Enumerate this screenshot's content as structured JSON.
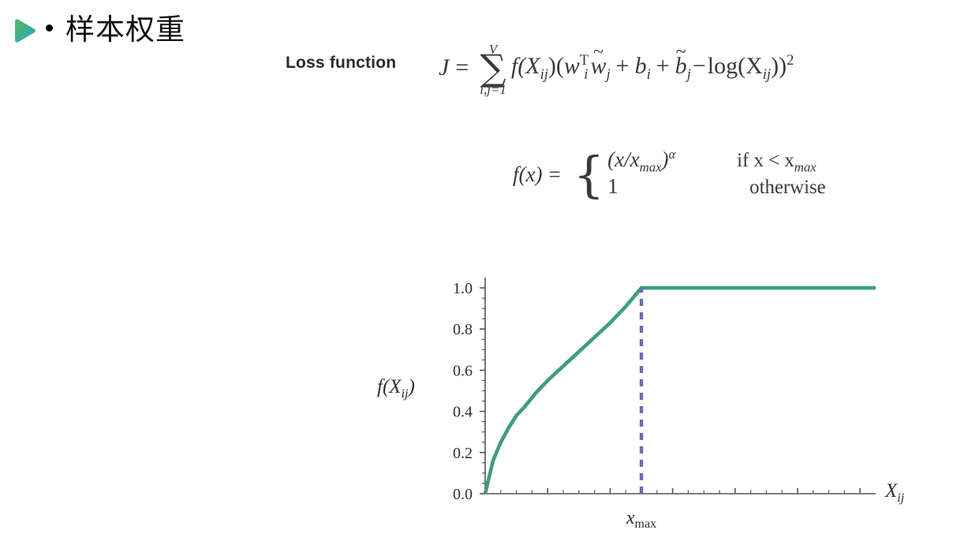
{
  "slide": {
    "heading": {
      "icon": "play-triangle-icon",
      "bullet": "•",
      "text": "样本权重"
    },
    "loss_label": "Loss function",
    "equations": {
      "main": {
        "lhs": "J",
        "equals": "=",
        "sum_upper": "V",
        "sum_symbol": "∑",
        "sum_lower": "i,j=1",
        "body_parts": {
          "weight_fn": "f(X",
          "weight_sub": "ij",
          "open": ")(",
          "w": "w",
          "w_sup": "T",
          "w_sub": "i",
          "wtilde": "w",
          "wtilde_sub": "j",
          "plus1": "+",
          "b": "b",
          "b_sub": "i",
          "plus2": "+",
          "btilde": "b",
          "btilde_sub": "j",
          "minus": "−",
          "log": "log(X",
          "log_sub": "ij",
          "close": "))",
          "power": "2"
        },
        "plain": "J = sum_{i,j=1}^{V} f(X_ij)(w_i^T w̃_j + b_i + b̃_j − log(X_ij))^2"
      },
      "piecewise": {
        "lhs": "f(x)",
        "equals": "=",
        "case1_value": "(x/x",
        "case1_value_sub": "max",
        "case1_value_close": ")",
        "case1_value_pow": "α",
        "case1_cond": "if x < x",
        "case1_cond_sub": "max",
        "case2_value": "1",
        "case2_cond": "otherwise",
        "plain": "f(x) = { (x/x_max)^alpha if x < x_max ; 1 otherwise }"
      }
    },
    "colors": {
      "curve": "#3f9d7c",
      "dashed_line": "#6b6bba",
      "axis": "#555555",
      "text": "#2f2f2f",
      "icon_gradient_start": "#4caf50",
      "icon_gradient_end": "#2aa8e0",
      "background": "#ffffff"
    }
  },
  "chart_data": {
    "type": "line",
    "title": "",
    "xlabel": "X_ij",
    "ylabel": "f(X_ij)",
    "ylim": [
      0.0,
      1.05
    ],
    "xlim": [
      0,
      1
    ],
    "y_ticks": [
      "0.0",
      "0.2",
      "0.4",
      "0.6",
      "0.8",
      "1.0"
    ],
    "y_tick_values": [
      0.0,
      0.2,
      0.4,
      0.6,
      0.8,
      1.0
    ],
    "x_ticks": [],
    "grid": false,
    "legend": false,
    "annotations": [
      {
        "name": "x-max-marker",
        "label": "x_max",
        "x": 0.4,
        "type": "vertical-dashed-line",
        "color": "#6b6bba"
      }
    ],
    "series": [
      {
        "name": "f(x) = (x/x_max)^alpha, capped at 1",
        "color": "#3f9d7c",
        "x": [
          0.0,
          0.02,
          0.04,
          0.06,
          0.08,
          0.1,
          0.13,
          0.16,
          0.2,
          0.24,
          0.28,
          0.32,
          0.36,
          0.4,
          0.55,
          0.7,
          0.85,
          1.0
        ],
        "y": [
          0.0,
          0.16,
          0.25,
          0.32,
          0.38,
          0.42,
          0.49,
          0.55,
          0.62,
          0.69,
          0.76,
          0.83,
          0.91,
          1.0,
          1.0,
          1.0,
          1.0,
          1.0
        ]
      }
    ]
  }
}
